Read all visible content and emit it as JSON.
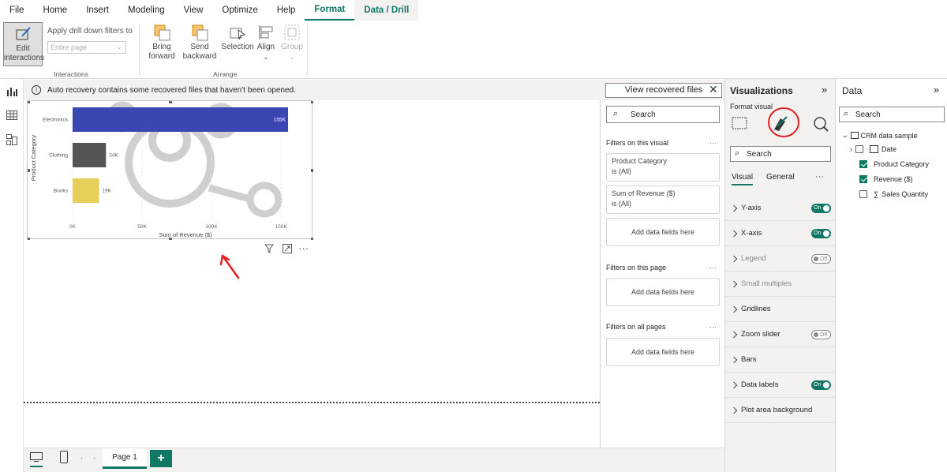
{
  "menu": [
    "File",
    "Home",
    "Insert",
    "Modeling",
    "View",
    "Optimize",
    "Help",
    "Format",
    "Data / Drill"
  ],
  "ribbon": {
    "edit_interactions": "Edit interactions",
    "apply_drill_label": "Apply drill down filters to",
    "apply_drill_placeholder": "Entire page",
    "interactions_group": "Interactions",
    "bring_forward": "Bring forward",
    "send_backward": "Send backward",
    "selection": "Selection",
    "align": "Align",
    "group": "Group",
    "arrange_group": "Arrange"
  },
  "notice": {
    "text": "Auto recovery contains some recovered files that haven't been opened.",
    "button": "View recovered files"
  },
  "chart_data": {
    "type": "bar",
    "orientation": "horizontal",
    "categories": [
      "Electronics",
      "Clothing",
      "Books"
    ],
    "values": [
      155000,
      24000,
      19000
    ],
    "data_labels": [
      "155K",
      "24K",
      "19K"
    ],
    "colors": [
      "#3b46b5",
      "#555555",
      "#e8cf5a"
    ],
    "xlabel": "Sum of Revenue ($)",
    "ylabel": "Product Category",
    "xticks": [
      "0K",
      "50K",
      "100K",
      "150K"
    ],
    "xlim": [
      0,
      155000
    ]
  },
  "filters": {
    "search_placeholder": "Search",
    "on_visual_title": "Filters on this visual",
    "card1_title": "Product Category",
    "card1_sub": "is (All)",
    "card2_title": "Sum of Revenue ($)",
    "card2_sub": "is (All)",
    "add_fields": "Add data fields here",
    "on_page_title": "Filters on this page",
    "on_all_title": "Filters on all pages",
    "more": "···"
  },
  "visualizations": {
    "title": "Visualizations",
    "format_visual": "Format visual",
    "search_placeholder": "Search",
    "tab_visual": "Visual",
    "tab_general": "General",
    "sections": [
      {
        "label": "Y-axis",
        "toggle": "On",
        "dim": false
      },
      {
        "label": "X-axis",
        "toggle": "On",
        "dim": false
      },
      {
        "label": "Legend",
        "toggle": "Off",
        "dim": true
      },
      {
        "label": "Small multiples",
        "toggle": "",
        "dim": true
      },
      {
        "label": "Gridlines",
        "toggle": "",
        "dim": false
      },
      {
        "label": "Zoom slider",
        "toggle": "Off",
        "dim": false
      },
      {
        "label": "Bars",
        "toggle": "",
        "dim": false
      },
      {
        "label": "Data labels",
        "toggle": "On",
        "dim": false
      },
      {
        "label": "Plot area background",
        "toggle": "",
        "dim": false
      }
    ]
  },
  "data_pane": {
    "title": "Data",
    "search_placeholder": "Search",
    "table": "CRM data sample",
    "fields": [
      {
        "label": "Date",
        "checked": false
      },
      {
        "label": "Product Category",
        "checked": true
      },
      {
        "label": "Revenue ($)",
        "checked": true
      },
      {
        "label": "Sales Quantity",
        "checked": false
      }
    ]
  },
  "page_tab": "Page 1"
}
